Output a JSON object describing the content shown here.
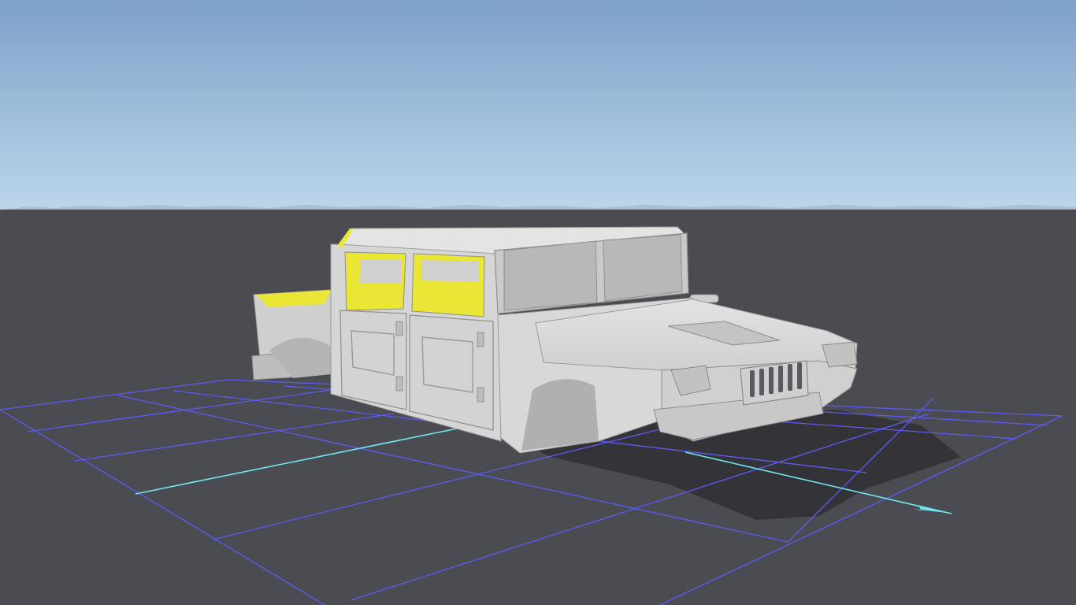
{
  "viewport": {
    "sky_top_color": "#7ea1c9",
    "sky_horizon_color": "#bcd6ea",
    "ground_color": "#4b4b52",
    "grid_color": "#5b5bf5",
    "axis_color": "#6fe6ef"
  },
  "model": {
    "body_color": "#d6d6d6",
    "selected_face_color": "#e9e635",
    "shadow_color": "#343438"
  },
  "icons": {
    "axis_arrow": "arrow-icon"
  }
}
